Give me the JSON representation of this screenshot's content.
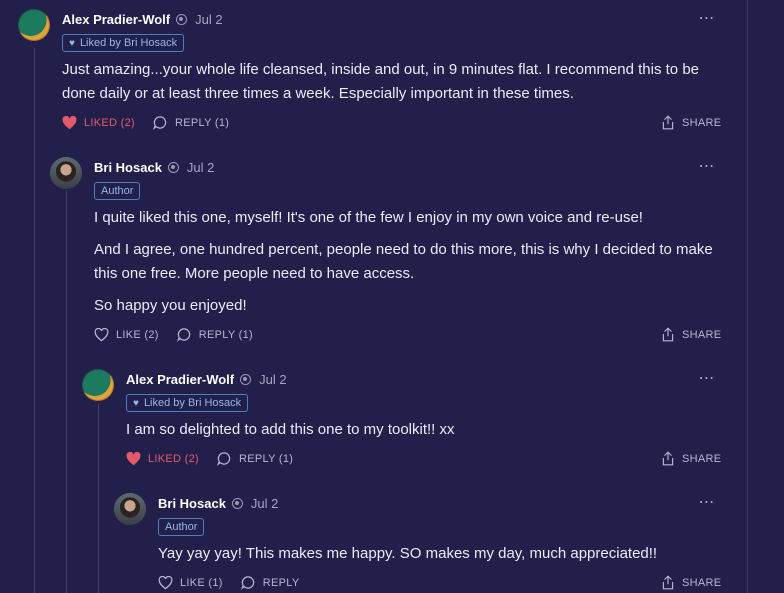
{
  "colors": {
    "background": "#22204a",
    "liked": "#e25a6a",
    "badge": "#8fb8ea"
  },
  "comments": [
    {
      "author": "Alex Pradier-Wolf",
      "date": "Jul 2",
      "badge": "Liked by Bri Hosack",
      "paragraphs": [
        "Just amazing...your whole life cleansed, inside and out, in 9 minutes flat. I recommend this to be done daily or at least three times a week. Especially important in these times."
      ],
      "like": "LIKED (2)",
      "reply": "REPLY (1)",
      "share": "SHARE",
      "more": "⋯"
    },
    {
      "author": "Bri Hosack",
      "date": "Jul 2",
      "badge": "Author",
      "paragraphs": [
        "I quite liked this one, myself! It's one of the few I enjoy in my own voice and re-use!",
        "And I agree, one hundred percent, people need to do this more, this is why I decided to make this one free. More people need to have access.",
        "So happy you enjoyed!"
      ],
      "like": "LIKE (2)",
      "reply": "REPLY (1)",
      "share": "SHARE",
      "more": "⋯"
    },
    {
      "author": "Alex Pradier-Wolf",
      "date": "Jul 2",
      "badge": "Liked by Bri Hosack",
      "paragraphs": [
        "I am so delighted to add this one to my toolkit!! xx"
      ],
      "like": "LIKED (2)",
      "reply": "REPLY (1)",
      "share": "SHARE",
      "more": "⋯"
    },
    {
      "author": "Bri Hosack",
      "date": "Jul 2",
      "badge": "Author",
      "paragraphs": [
        "Yay yay yay! This makes me happy. SO makes my day, much appreciated!!"
      ],
      "like": "LIKE (1)",
      "reply": "REPLY",
      "share": "SHARE",
      "more": "⋯"
    }
  ]
}
